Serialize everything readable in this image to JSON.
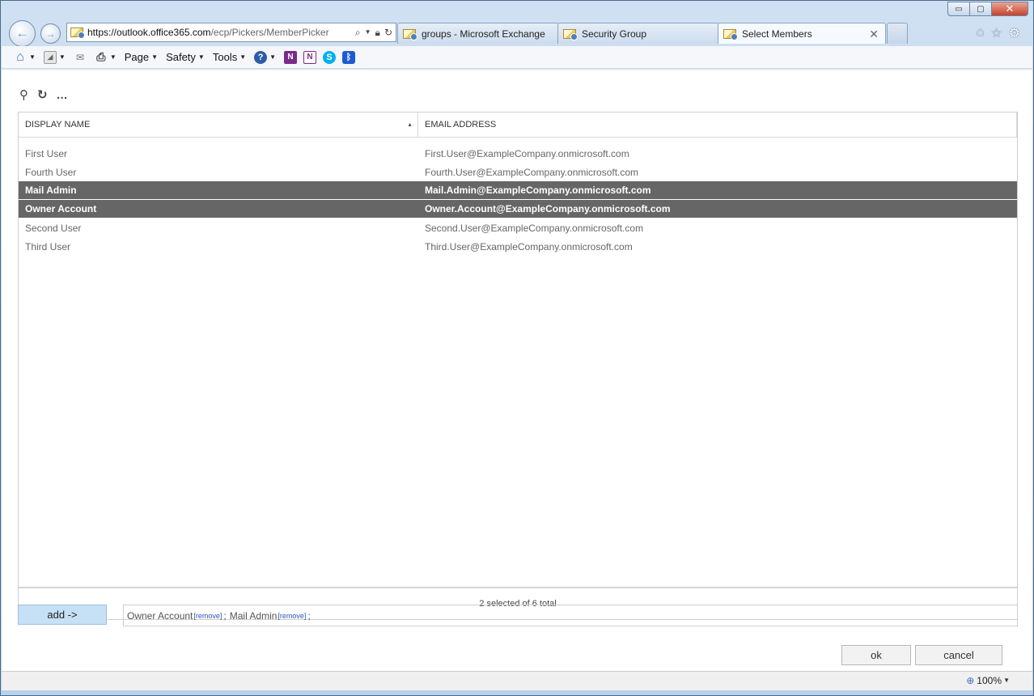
{
  "browser": {
    "url_prefix": "https://",
    "url_host": "outlook.office365.com",
    "url_path": "/ecp/Pickers/MemberPicker",
    "tabs": [
      {
        "label": "groups - Microsoft Exchange"
      },
      {
        "label": "Security Group"
      },
      {
        "label": "Select Members"
      }
    ],
    "icons": [
      "back-arrow-icon",
      "forward-arrow-icon",
      "home-icon",
      "star-icon",
      "gear-icon"
    ],
    "window_controls": {
      "minimize": "▭",
      "maximize": "▢",
      "close": "✕"
    }
  },
  "commandbar": {
    "page": "Page",
    "safety": "Safety",
    "tools": "Tools"
  },
  "grid": {
    "columns": [
      "DISPLAY NAME",
      "EMAIL ADDRESS"
    ],
    "rows": [
      {
        "name": "First User",
        "email": "First.User@ExampleCompany.onmicrosoft.com",
        "selected": false
      },
      {
        "name": "Fourth User",
        "email": "Fourth.User@ExampleCompany.onmicrosoft.com",
        "selected": false
      },
      {
        "name": "Mail Admin",
        "email": "Mail.Admin@ExampleCompany.onmicrosoft.com",
        "selected": true
      },
      {
        "name": "Owner Account",
        "email": "Owner.Account@ExampleCompany.onmicrosoft.com",
        "selected": true
      },
      {
        "name": "Second User",
        "email": "Second.User@ExampleCompany.onmicrosoft.com",
        "selected": false
      },
      {
        "name": "Third User",
        "email": "Third.User@ExampleCompany.onmicrosoft.com",
        "selected": false
      }
    ],
    "footer": "2 selected of 6 total"
  },
  "picker": {
    "add_label": "add ->",
    "selected": [
      {
        "name": "Owner Account",
        "remove": "[remove]"
      },
      {
        "name": "Mail Admin",
        "remove": "[remove]"
      }
    ],
    "separator": ";"
  },
  "actions": {
    "ok": "ok",
    "cancel": "cancel"
  },
  "status": {
    "zoom": "100%"
  }
}
